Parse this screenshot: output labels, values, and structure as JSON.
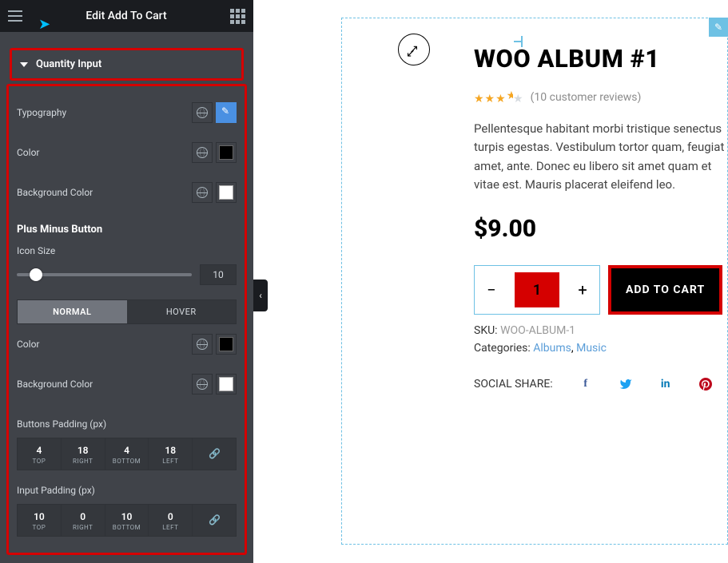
{
  "panel": {
    "title": "Edit Add To Cart",
    "accordion_label": "Quantity Input",
    "rows": {
      "typography": "Typography",
      "color": "Color",
      "bgcolor": "Background Color"
    },
    "plus_minus": {
      "heading": "Plus Minus Button",
      "icon_size_label": "Icon Size",
      "icon_size_value": "10",
      "tab_normal": "NORMAL",
      "tab_hover": "HOVER",
      "color": "Color",
      "bgcolor": "Background Color"
    },
    "buttons_padding": {
      "label": "Buttons Padding (px)",
      "top": "4",
      "right": "18",
      "bottom": "4",
      "left": "18",
      "k_top": "TOP",
      "k_right": "RIGHT",
      "k_bottom": "BOTTOM",
      "k_left": "LEFT"
    },
    "input_padding": {
      "label": "Input Padding (px)",
      "top": "10",
      "right": "0",
      "bottom": "10",
      "left": "0",
      "k_top": "TOP",
      "k_right": "RIGHT",
      "k_bottom": "BOTTOM",
      "k_left": "LEFT"
    }
  },
  "product": {
    "title": "WOO ALBUM #1",
    "stars_full": "★★★",
    "stars_half": "★",
    "stars_empty": "★",
    "reviews": "(10 customer reviews)",
    "desc": "Pellentesque habitant morbi tristique senectus turpis egestas. Vestibulum tortor quam, feugiat amet, ante. Donec eu libero sit amet quam et vitae est. Mauris placerat eleifend leo.",
    "price": "$9.00",
    "qty": "1",
    "add_label": "ADD TO CART",
    "sku_k": "SKU:",
    "sku_v": "WOO-ALBUM-1",
    "cat_k": "Categories:",
    "cat_a": "Albums",
    "cat_sep": ", ",
    "cat_b": "Music",
    "share_label": "SOCIAL SHARE:"
  },
  "collapse_caret": "‹"
}
